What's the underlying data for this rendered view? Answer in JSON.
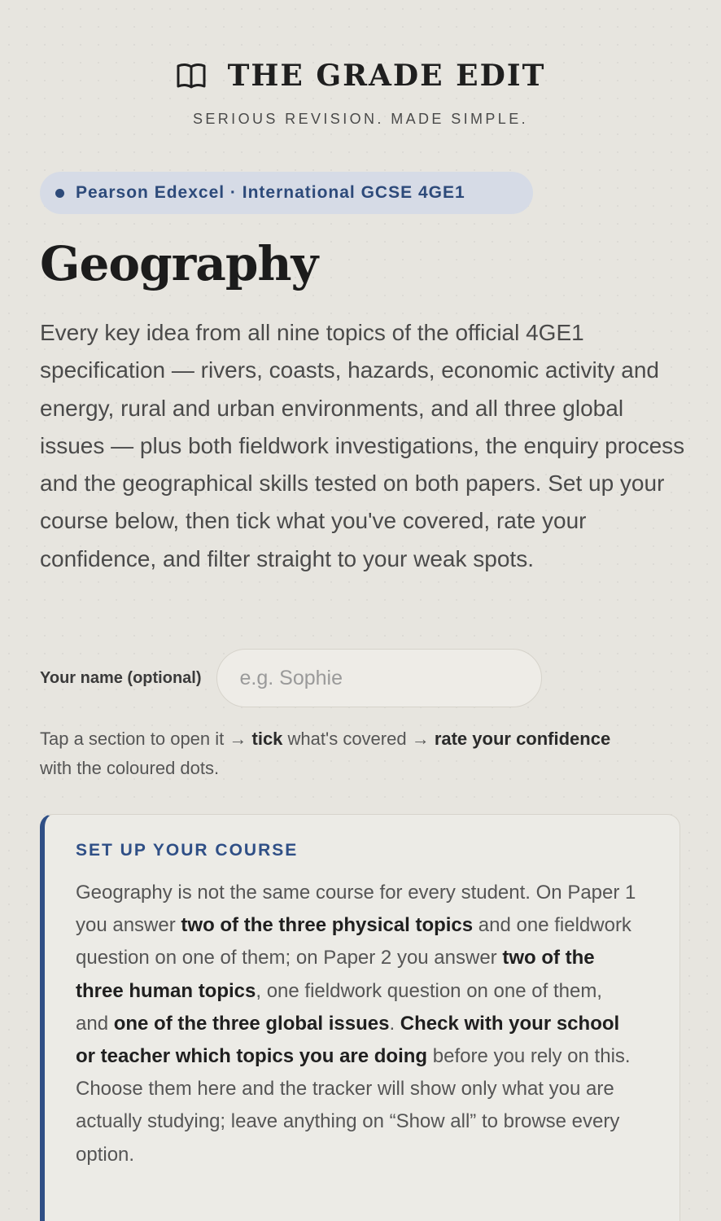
{
  "brand": {
    "title": "THE GRADE EDIT",
    "tagline": "SERIOUS REVISION. MADE SIMPLE.",
    "icon": "book-icon"
  },
  "badge": {
    "label": "Pearson Edexcel · International GCSE 4GE1"
  },
  "page": {
    "title": "Geography",
    "intro": "Every key idea from all nine topics of the official 4GE1 specification — rivers, coasts, hazards, economic activity and energy, rural and urban environments, and all three global issues — plus both fieldwork investigations, the enquiry process and the geographical skills tested on both papers. Set up your course below, then tick what you've covered, rate your confidence, and filter straight to your weak spots."
  },
  "name_field": {
    "label": "Your name (optional)",
    "placeholder": "e.g. Sophie",
    "value": ""
  },
  "hint": {
    "part1": "Tap a section to open it → ",
    "bold1": "tick",
    "part2": " what's covered → ",
    "bold2": "rate your confidence",
    "part3": " with the coloured dots."
  },
  "setup_card": {
    "title": "SET UP YOUR COURSE",
    "t1": "Geography is not the same course for every student. On Paper 1 you answer ",
    "b1": "two of the three physical topics",
    "t2": " and one fieldwork question on one of them; on Paper 2 you answer ",
    "b2": "two of the three human topics",
    "t3": ", one fieldwork question on one of them, and ",
    "b3": "one of the three global issues",
    "t4": ". ",
    "b4": "Check with your school or teacher which topics you are doing",
    "t5": " before you rely on this. Choose them here and the tracker will show only what you are actually studying; leave anything on “Show all” to browse every option."
  },
  "colors": {
    "accent": "#2f4f86",
    "badge_bg": "#d6dbe6",
    "background": "#e7e5df"
  }
}
